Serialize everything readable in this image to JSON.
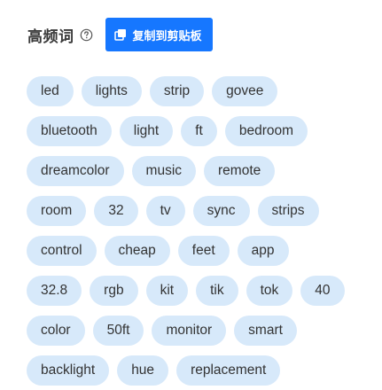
{
  "header": {
    "title": "高频词",
    "help_icon": "question-circle-icon",
    "copy_button_label": "复制到剪贴板",
    "copy_icon": "copy-icon",
    "accent_color": "#1677ff",
    "tag_background": "#d7e9fa"
  },
  "tag_rows": [
    [
      "led",
      "lights",
      "strip",
      "govee"
    ],
    [
      "bluetooth",
      "light",
      "ft",
      "bedroom"
    ],
    [
      "dreamcolor",
      "music",
      "remote"
    ],
    [
      "room",
      "32",
      "tv",
      "sync",
      "strips"
    ],
    [
      "control",
      "cheap",
      "feet",
      "app"
    ],
    [
      "32.8",
      "rgb",
      "kit",
      "tik",
      "tok",
      "40"
    ],
    [
      "color",
      "50ft",
      "monitor",
      "smart"
    ],
    [
      "backlight",
      "hue",
      "replacement"
    ]
  ]
}
